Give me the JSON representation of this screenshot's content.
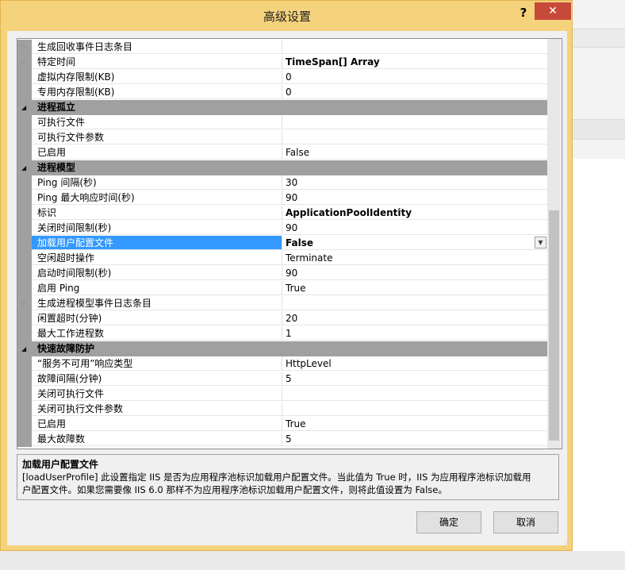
{
  "dialog": {
    "title": "高级设置",
    "help": "?",
    "close": "✕"
  },
  "grid": {
    "rows": [
      {
        "type": "prop",
        "expander": "▷",
        "name": "生成回收事件日志条目",
        "value": ""
      },
      {
        "type": "prop",
        "expander": "▷",
        "name": "特定时间",
        "value": "TimeSpan[] Array",
        "bold": true
      },
      {
        "type": "prop",
        "name": "虚拟内存限制(KB)",
        "value": "0"
      },
      {
        "type": "prop",
        "name": "专用内存限制(KB)",
        "value": "0"
      },
      {
        "type": "cat",
        "expander": "◢",
        "name": "进程孤立"
      },
      {
        "type": "prop",
        "name": "可执行文件",
        "value": ""
      },
      {
        "type": "prop",
        "name": "可执行文件参数",
        "value": ""
      },
      {
        "type": "prop",
        "name": "已启用",
        "value": "False"
      },
      {
        "type": "cat",
        "expander": "◢",
        "name": "进程模型"
      },
      {
        "type": "prop",
        "name": "Ping 间隔(秒)",
        "value": "30"
      },
      {
        "type": "prop",
        "name": "Ping 最大响应时间(秒)",
        "value": "90"
      },
      {
        "type": "prop",
        "name": "标识",
        "value": "ApplicationPoolIdentity",
        "bold": true
      },
      {
        "type": "prop",
        "name": "关闭时间限制(秒)",
        "value": "90"
      },
      {
        "type": "prop",
        "name": "加载用户配置文件",
        "value": "False",
        "selected": true
      },
      {
        "type": "prop",
        "name": "空闲超时操作",
        "value": "Terminate"
      },
      {
        "type": "prop",
        "name": "启动时间限制(秒)",
        "value": "90"
      },
      {
        "type": "prop",
        "name": "启用 Ping",
        "value": "True"
      },
      {
        "type": "prop",
        "expander": "▷",
        "name": "生成进程模型事件日志条目",
        "value": ""
      },
      {
        "type": "prop",
        "name": "闲置超时(分钟)",
        "value": "20"
      },
      {
        "type": "prop",
        "name": "最大工作进程数",
        "value": "1"
      },
      {
        "type": "cat",
        "expander": "◢",
        "name": "快速故障防护"
      },
      {
        "type": "prop",
        "name": "“服务不可用”响应类型",
        "value": "HttpLevel"
      },
      {
        "type": "prop",
        "name": "故障间隔(分钟)",
        "value": "5"
      },
      {
        "type": "prop",
        "name": "关闭可执行文件",
        "value": ""
      },
      {
        "type": "prop",
        "name": "关闭可执行文件参数",
        "value": ""
      },
      {
        "type": "prop",
        "name": "已启用",
        "value": "True"
      },
      {
        "type": "prop",
        "name": "最大故障数",
        "value": "5"
      }
    ]
  },
  "description": {
    "title": "加载用户配置文件",
    "line1": "[loadUserProfile] 此设置指定 IIS 是否为应用程序池标识加载用户配置文件。当此值为 True 时，IIS 为应用程序池标识加载用",
    "line2": "户配置文件。如果您需要像 IIS 6.0 那样不为应用程序池标识加载用户配置文件，则将此值设置为 False。"
  },
  "buttons": {
    "ok": "确定",
    "cancel": "取消"
  },
  "colors": {
    "frame": "#f5d27c",
    "close": "#c7493a",
    "selection": "#3399ff",
    "category": "#a0a0a0"
  }
}
